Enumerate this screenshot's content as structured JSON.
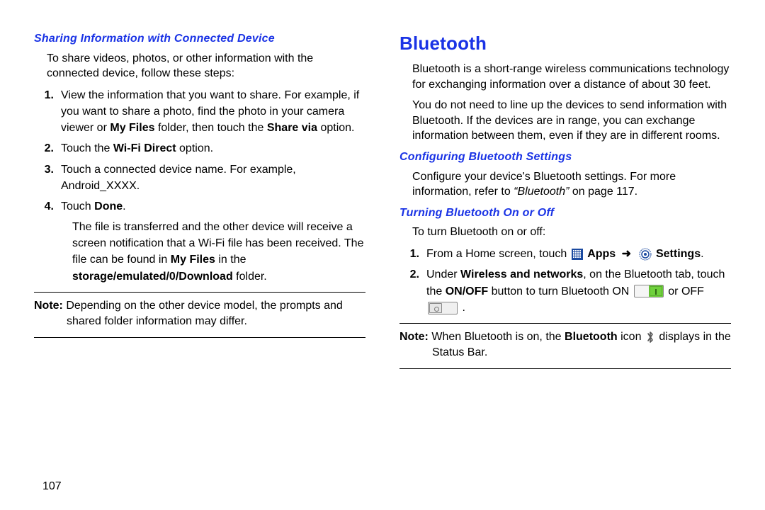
{
  "pageNumber": "107",
  "left": {
    "subheading": "Sharing Information with Connected Device",
    "intro": "To share videos, photos, or other information with the connected device, follow these steps:",
    "step1_pre": "View the information that you want to share. For example, if you want to share a photo, find the photo in your camera viewer or ",
    "step1_bold1": "My Files",
    "step1_mid": " folder, then touch the ",
    "step1_bold2": "Share via",
    "step1_post": " option.",
    "step2_pre": "Touch the ",
    "step2_bold": "Wi-Fi Direct",
    "step2_post": " option.",
    "step3": "Touch a connected device name. For example, Android_XXXX.",
    "step4_pre": "Touch ",
    "step4_bold": "Done",
    "step4_post": ".",
    "step4_para_a": "The file is transferred and the other device will receive a screen notification that a Wi-Fi file has been received. The file can be found in ",
    "step4_para_bold1": "My Files",
    "step4_para_b": " in the ",
    "step4_para_bold2": "storage/emulated/0/Download",
    "step4_para_c": " folder.",
    "note_label": "Note:",
    "note_body": " Depending on the other device model, the prompts and shared folder information may differ."
  },
  "right": {
    "heading": "Bluetooth",
    "p1": "Bluetooth is a short-range wireless communications technology for exchanging information over a distance of about 30 feet.",
    "p2": "You do not need to line up the devices to send information with Bluetooth. If the devices are in range, you can exchange information between them, even if they are in different rooms.",
    "sub1": "Configuring Bluetooth Settings",
    "conf_a": "Configure your device's Bluetooth settings. For more information, refer to ",
    "conf_ref": "“Bluetooth”",
    "conf_b": " on page 117.",
    "sub2": "Turning Bluetooth On or Off",
    "turn_intro": "To turn Bluetooth on or off:",
    "r1_pre": "From a Home screen, touch ",
    "r1_apps": "Apps",
    "r1_settings": "Settings",
    "r1_post": ".",
    "r2_pre": "Under ",
    "r2_bold1": "Wireless and networks",
    "r2_mid": ", on the Bluetooth tab, touch the ",
    "r2_bold2": "ON/OFF",
    "r2_mid2": " button to turn Bluetooth ON ",
    "r2_or": " or OFF ",
    "r2_post": ".",
    "note_label": "Note:",
    "note_a": " When Bluetooth is on, the ",
    "note_bold": "Bluetooth",
    "note_b": " icon ",
    "note_c": " displays in the Status Bar."
  },
  "nums": {
    "n1": "1.",
    "n2": "2.",
    "n3": "3.",
    "n4": "4."
  },
  "icons": {
    "apps": "apps-grid-icon",
    "arrow": "➜",
    "settings": "settings-gear-icon",
    "toggleOn": "toggle-on-icon",
    "toggleOff": "toggle-off-icon",
    "bluetooth": "bluetooth-icon"
  }
}
